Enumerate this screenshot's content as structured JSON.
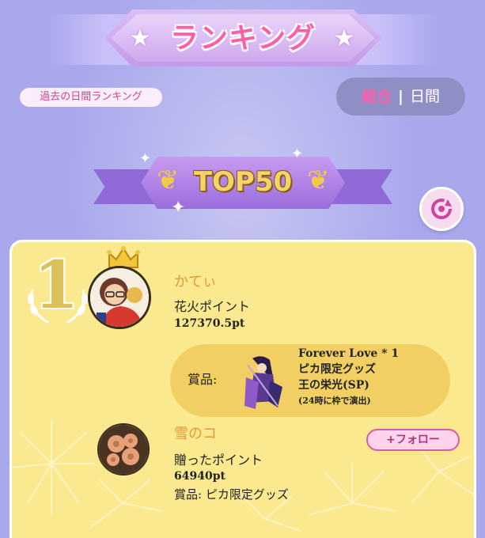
{
  "header": {
    "title": "ランキング"
  },
  "past_link": {
    "label": "過去の日間ランキング"
  },
  "toggle": {
    "active_label": "総合",
    "separator": "|",
    "inactive_label": "日間"
  },
  "banner": {
    "label": "TOP50"
  },
  "colors": {
    "background": "#a9a8ec",
    "accent_pink": "#ff5fa8",
    "card_yellow": "#fbe98f",
    "gold": "#dcc05a"
  },
  "ranking": {
    "rank": "1",
    "winner": {
      "name": "かてぃ",
      "point_label": "花火ポイント",
      "points": "127370.5pt"
    },
    "prize": {
      "label": "賞品:",
      "lines": [
        "Forever Love * 1",
        "ピカ限定グッズ",
        "王の栄光(SP)",
        "(24時に枠で演出)"
      ]
    },
    "supporter": {
      "name": "雪のコ",
      "point_label": "贈ったポイント",
      "points": "64940pt",
      "prize": "賞品: ピカ限定グッズ",
      "follow_label": "+フォロー"
    }
  },
  "icons": {
    "title_star": "star-icon",
    "refresh": "refresh-icon",
    "crown": "crown-icon",
    "laurel": "laurel-icon"
  }
}
